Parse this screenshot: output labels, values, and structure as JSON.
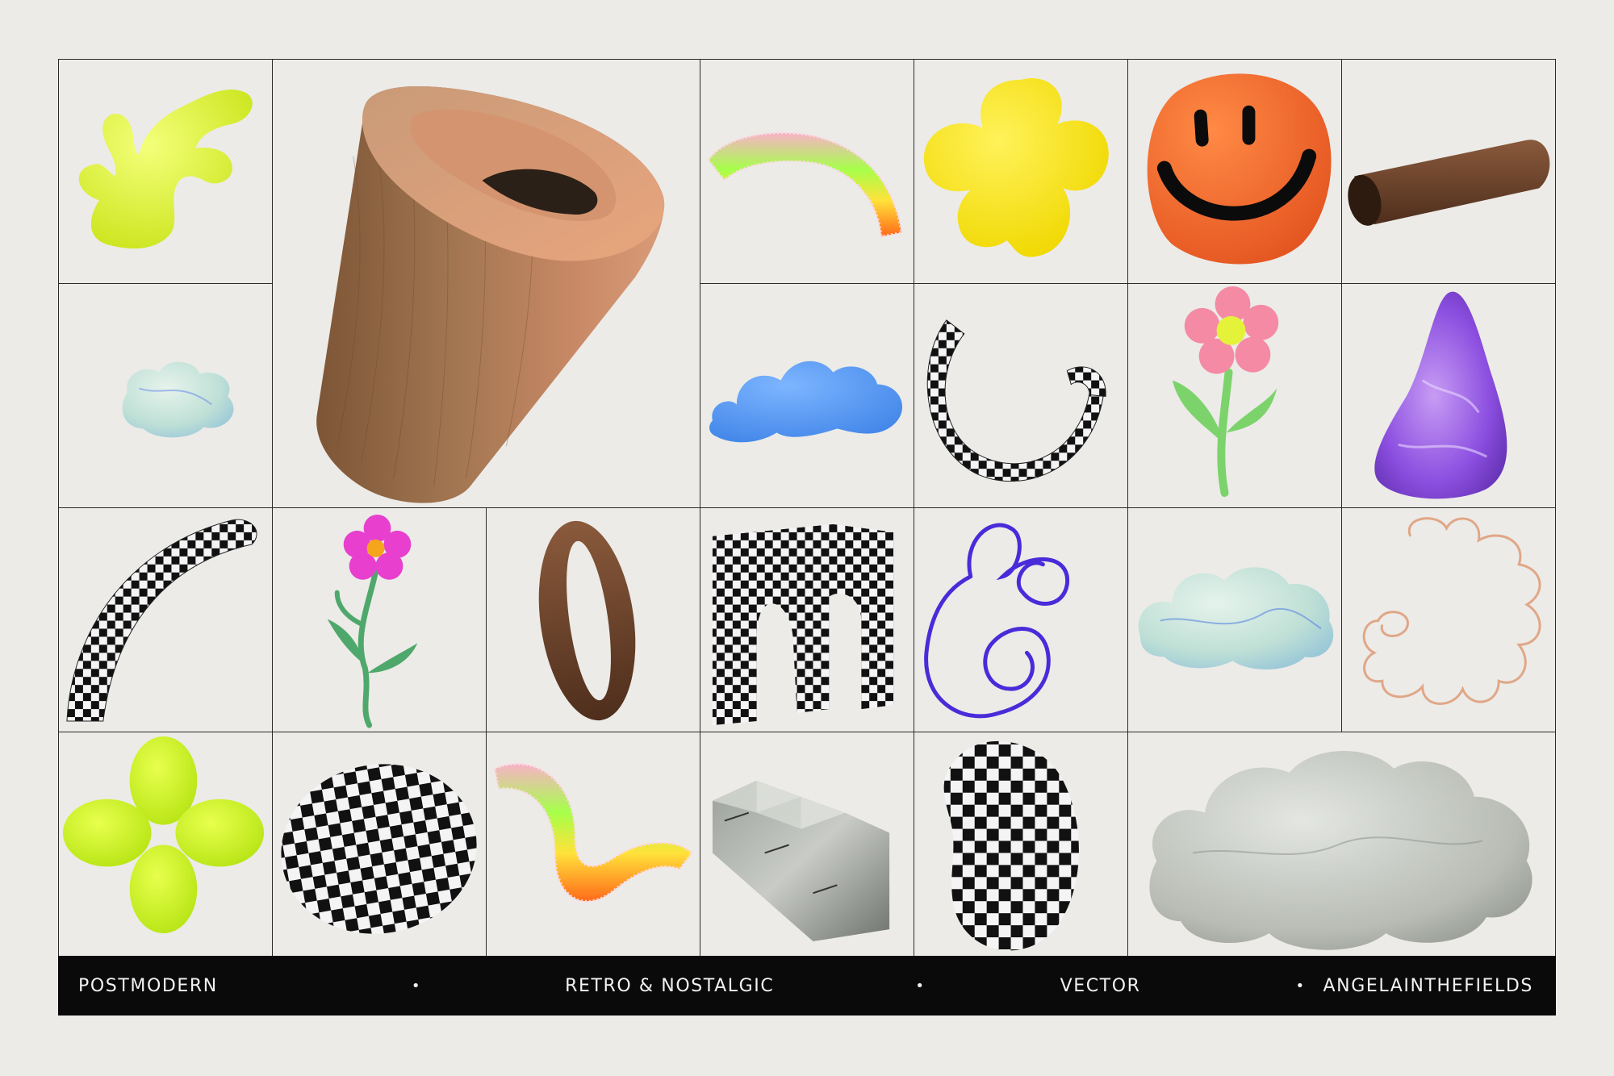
{
  "footer": {
    "items": [
      "POSTMODERN",
      "RETRO & NOSTALGIC",
      "VECTOR",
      "ANGELAINTHEFIELDS"
    ],
    "separator": "•"
  },
  "shapes": [
    {
      "name": "lime-blob",
      "row": 1,
      "col": 1
    },
    {
      "name": "wood-cone",
      "row": 1,
      "col": 2,
      "span": "2x2"
    },
    {
      "name": "fuzzy-rainbow-arc",
      "row": 1,
      "col": 4
    },
    {
      "name": "yellow-clover",
      "row": 1,
      "col": 5
    },
    {
      "name": "orange-smiley-face",
      "row": 1,
      "col": 6
    },
    {
      "name": "brown-cylinder",
      "row": 1,
      "col": 7
    },
    {
      "name": "marble-small-cloud",
      "row": 2,
      "col": 1
    },
    {
      "name": "blue-fuzzy-cloud",
      "row": 2,
      "col": 4
    },
    {
      "name": "checkered-ring",
      "row": 2,
      "col": 5
    },
    {
      "name": "pink-flower",
      "row": 2,
      "col": 6
    },
    {
      "name": "purple-marble-cone",
      "row": 2,
      "col": 7
    },
    {
      "name": "checkered-arc",
      "row": 3,
      "col": 1
    },
    {
      "name": "magenta-flower",
      "row": 3,
      "col": 2
    },
    {
      "name": "brown-ring",
      "row": 3,
      "col": 3
    },
    {
      "name": "checkered-arch",
      "row": 3,
      "col": 4
    },
    {
      "name": "purple-squiggle",
      "row": 3,
      "col": 5
    },
    {
      "name": "marble-cloud",
      "row": 3,
      "col": 6
    },
    {
      "name": "peach-outline-squiggle",
      "row": 3,
      "col": 7
    },
    {
      "name": "lime-four-leaf",
      "row": 4,
      "col": 1
    },
    {
      "name": "checkered-egg",
      "row": 4,
      "col": 2
    },
    {
      "name": "fuzzy-rainbow-wave",
      "row": 4,
      "col": 3
    },
    {
      "name": "marble-stairs",
      "row": 4,
      "col": 4
    },
    {
      "name": "checkered-bean",
      "row": 4,
      "col": 5
    },
    {
      "name": "stone-big-cloud",
      "row": 4,
      "col": 6,
      "span": "1x2"
    }
  ]
}
